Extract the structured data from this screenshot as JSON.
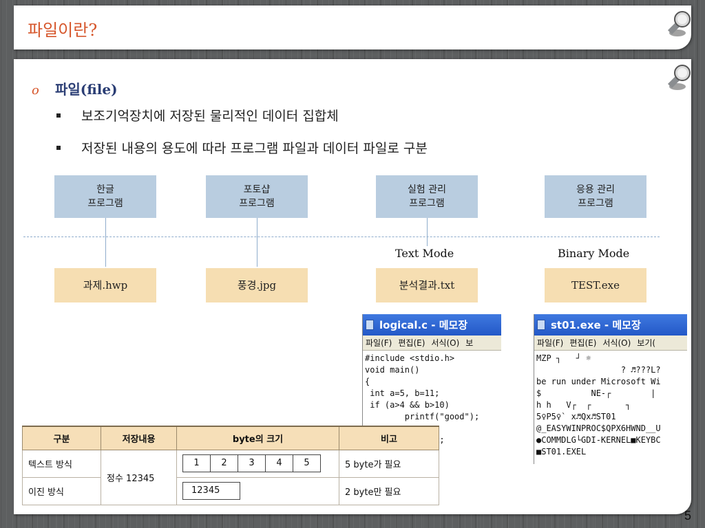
{
  "slide": {
    "title": "파일이란?",
    "page_number": "5"
  },
  "content": {
    "bullet_main_mark": "o",
    "bullet_main": "파일(file)",
    "sub_bullets": [
      "보조기억장치에 저장된 물리적인 데이터 집합체",
      "저장된 내용의 용도에 따라 프로그램 파일과 데이터 파일로 구분"
    ]
  },
  "diagram": {
    "programs": [
      {
        "line1": "한글",
        "line2": "프로그램"
      },
      {
        "line1": "포토샵",
        "line2": "프로그램"
      },
      {
        "line1": "실험 관리",
        "line2": "프로그램"
      },
      {
        "line1": "응용 관리",
        "line2": "프로그램"
      }
    ],
    "files": [
      "과제.hwp",
      "풍경.jpg",
      "분석결과.txt",
      "TEST.exe"
    ],
    "modes": {
      "text": "Text Mode",
      "binary": "Binary Mode"
    }
  },
  "notepad_text": {
    "title": "logical.c - 메모장",
    "menu": [
      "파일(F)",
      "편집(E)",
      "서식(O)",
      "보"
    ],
    "lines": [
      "#include <stdio.h>",
      "void main()",
      "{",
      " int a=5, b=11;",
      " if (a>4 && b>10)",
      "        printf(\"good\");",
      "",
      "       f(\"bad\");"
    ]
  },
  "notepad_binary": {
    "title": "st01.exe - 메모장",
    "menu": [
      "파일(F)",
      "편집(E)",
      "서식(O)",
      "보기("
    ],
    "lines": [
      "MZP ┐   ┘ ☼",
      "                 ? ♬???L?",
      "be run under Microsoft Wi",
      "$          NE-┌        |",
      "h h   V┌  ┌       ┐",
      "5♀P5♀` x♬Qx♬ST01",
      "@_EASYWINPROC$QPX6HWND__U",
      "●COMMDLG└GDI-KERNEL■KEYBC",
      "■ST01.EXEL"
    ]
  },
  "table": {
    "headers": [
      "구분",
      "저장내용",
      "byte의 크기",
      "비고"
    ],
    "rows": [
      {
        "type": "텍스트 방식",
        "note": "5 byte가 필요",
        "bytes": [
          "1",
          "2",
          "3",
          "4",
          "5"
        ]
      },
      {
        "type": "이진 방식",
        "note": "2 byte만 필요",
        "bytes": [
          "12345"
        ]
      }
    ],
    "content": "정수 12345"
  },
  "colors": {
    "title": "#d6562b",
    "main_bullet_text": "#2a3d74",
    "program_box": "#b9cde0",
    "file_box": "#f6deb2",
    "table_header": "#f6dfb8"
  }
}
